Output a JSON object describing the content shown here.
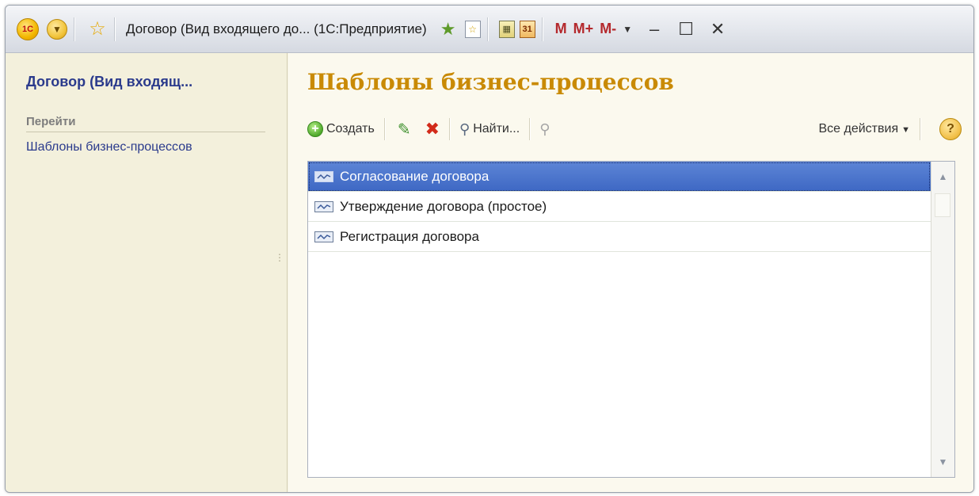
{
  "titlebar": {
    "logo_label": "1С",
    "title": "Договор (Вид входящего до... (1С:Предприятие)",
    "calendar_label": "31",
    "mem_m": "M",
    "mem_mplus": "M+",
    "mem_mminus": "M-"
  },
  "nav": {
    "title": "Договор (Вид входящ...",
    "section": "Перейти",
    "links": [
      "Шаблоны бизнес-процессов"
    ]
  },
  "main": {
    "title": "Шаблоны бизнес-процессов",
    "toolbar": {
      "create_label": "Создать",
      "find_label": "Найти...",
      "all_actions_label": "Все действия"
    },
    "list": {
      "rows": [
        {
          "label": "Согласование договора",
          "selected": true
        },
        {
          "label": "Утверждение договора (простое)",
          "selected": false
        },
        {
          "label": "Регистрация договора",
          "selected": false
        }
      ]
    }
  },
  "icons": {
    "logo": "1c-logo-icon",
    "menu": "main-menu-icon",
    "favorites": "star-icon",
    "add_favorites": "add-favorites-icon",
    "favorites_doc": "favorites-doc-icon",
    "calculator": "calculator-icon",
    "calendar": "calendar-icon",
    "create": "plus-icon",
    "edit": "pencil-icon",
    "delete": "delete-icon",
    "find": "magnifier-icon",
    "clear_search": "clear-search-icon",
    "help": "help-icon"
  },
  "colors": {
    "accent_title": "#c98a05",
    "nav_link": "#2a3a8c",
    "selection": "#3e68c4"
  }
}
